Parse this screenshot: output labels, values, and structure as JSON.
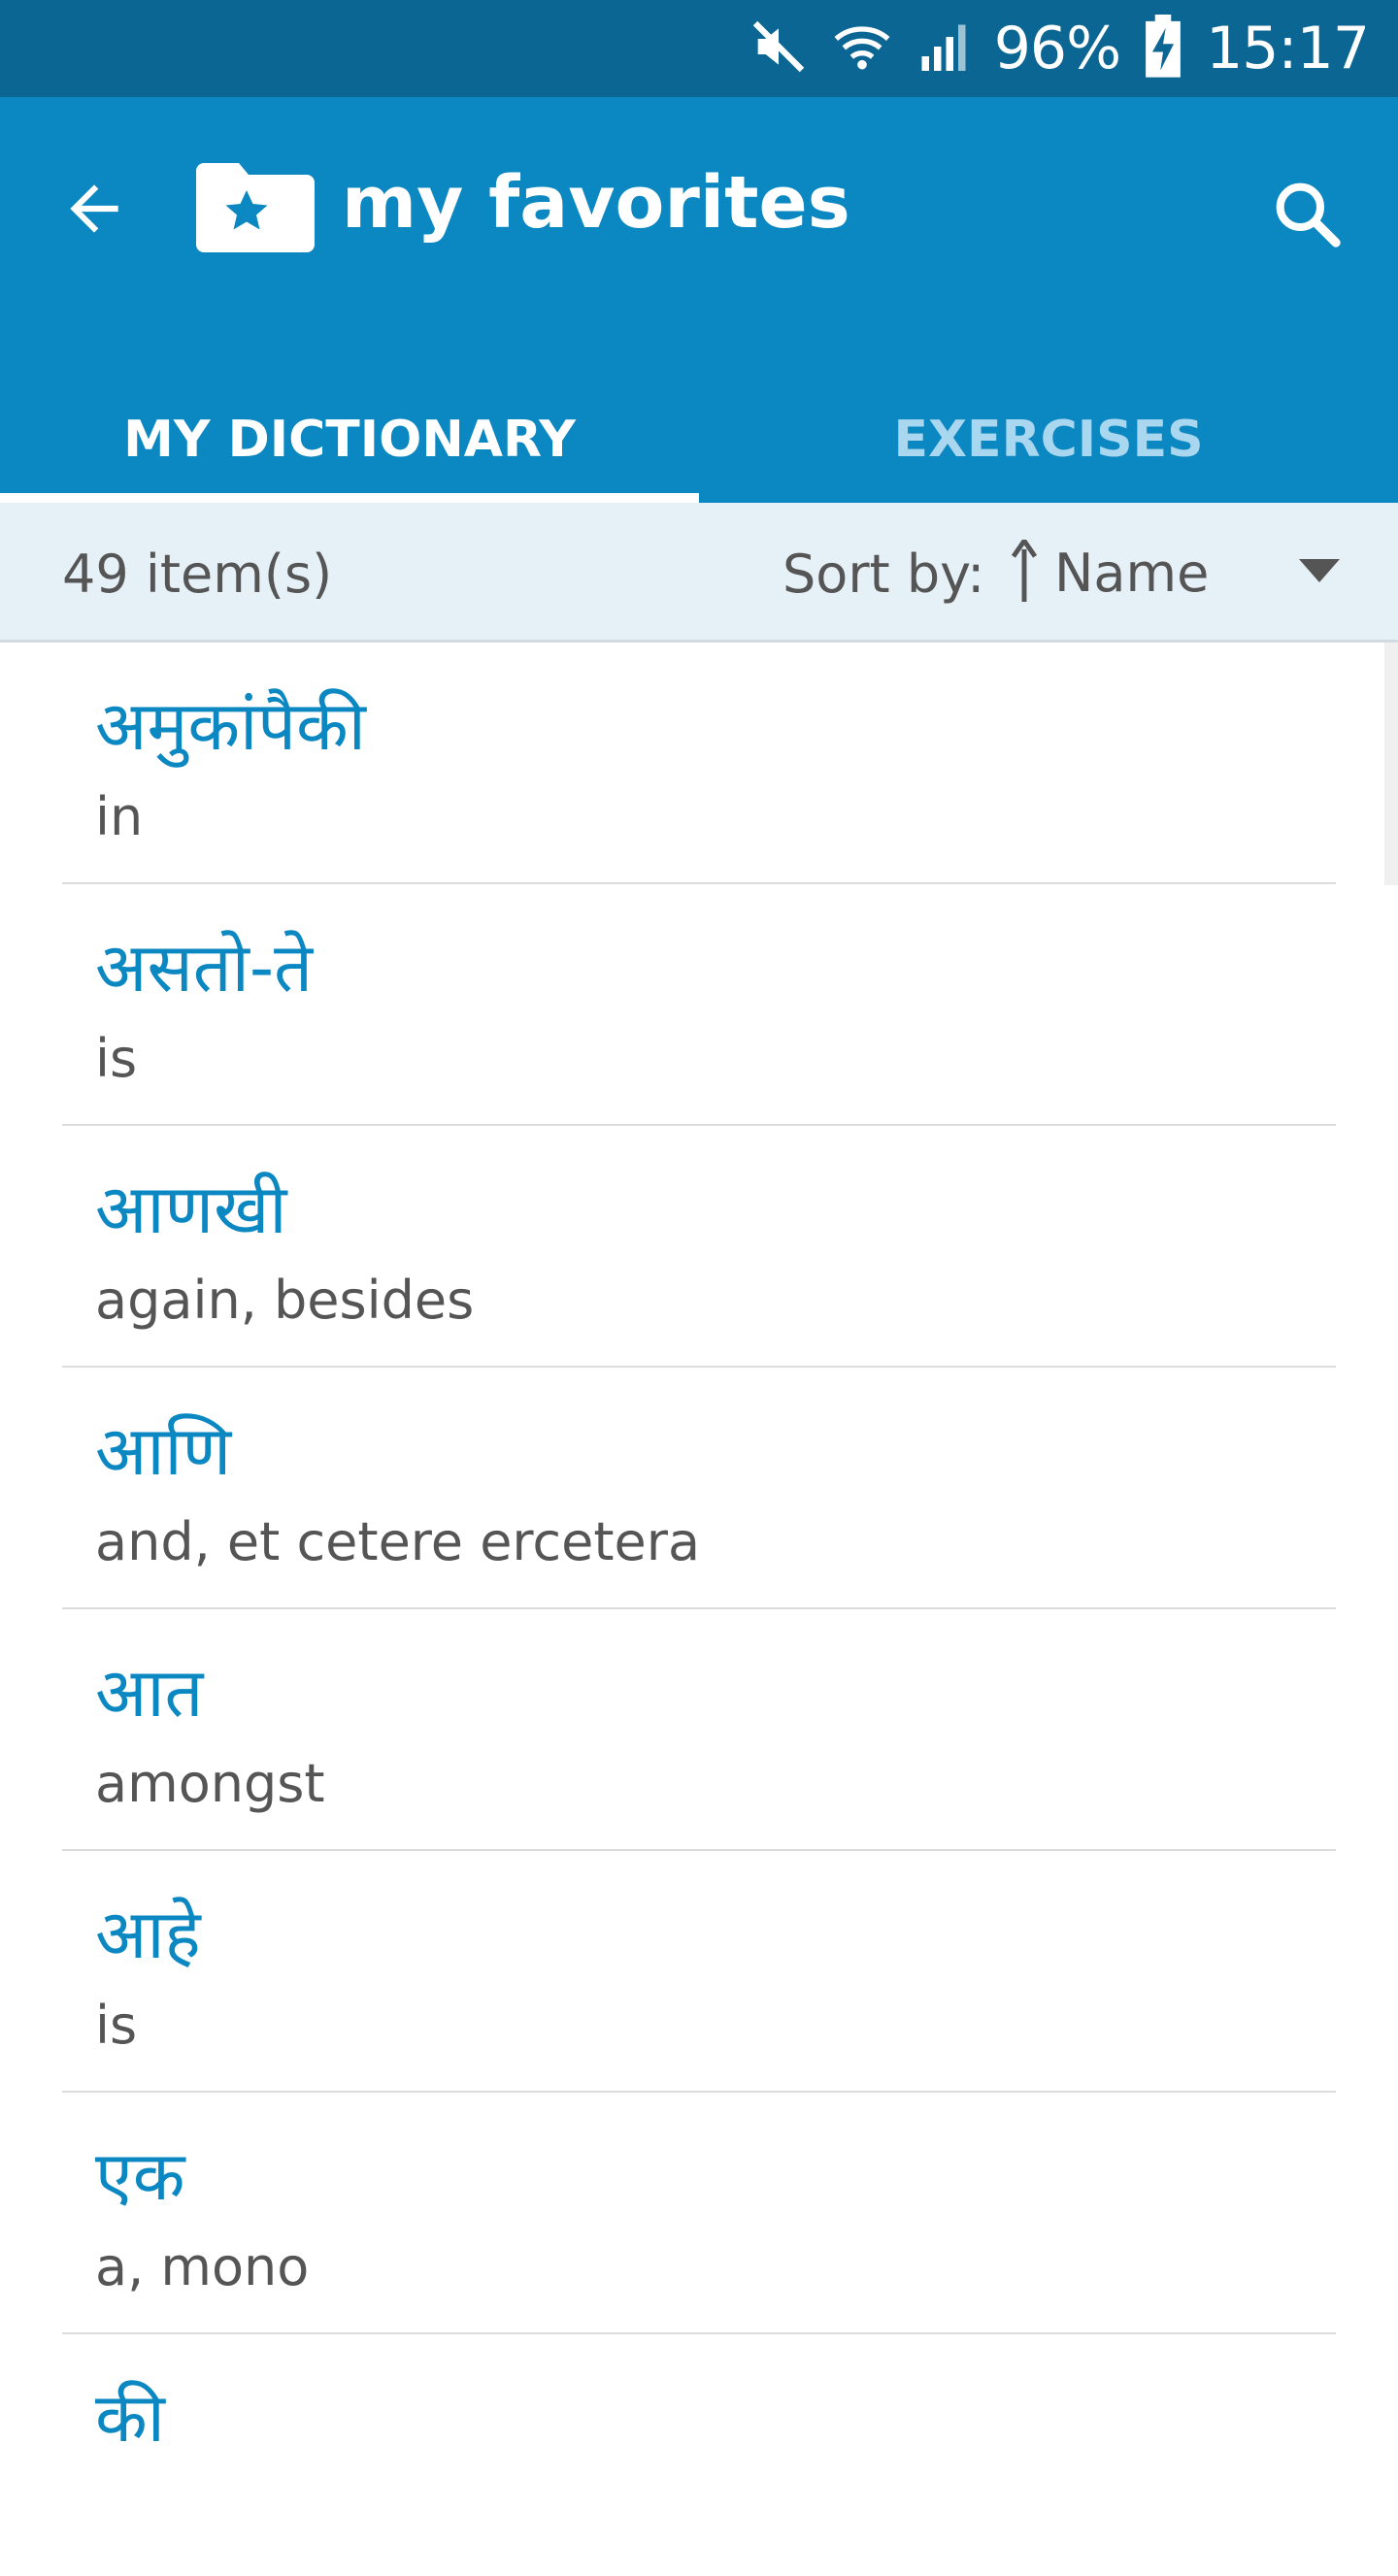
{
  "status_bar": {
    "battery": "96%",
    "time": "15:17",
    "icons": [
      "mute-icon",
      "wifi-icon",
      "signal-icon",
      "battery-charging-icon"
    ]
  },
  "app_bar": {
    "title": "my favorites",
    "back_icon": "arrow-left-icon",
    "folder_icon": "folder-star-icon",
    "search_icon": "search-icon"
  },
  "tabs": [
    {
      "label": "MY DICTIONARY",
      "active": true
    },
    {
      "label": "EXERCISES",
      "active": false
    }
  ],
  "sort_bar": {
    "count": "49 item(s)",
    "sort_label": "Sort by:",
    "sort_value": "Name",
    "sort_direction_icon": "arrow-up-icon",
    "dropdown_icon": "caret-down-icon"
  },
  "items": [
    {
      "term": "अमुकांपैकी",
      "meaning": "in"
    },
    {
      "term": "असतो-ते",
      "meaning": "is"
    },
    {
      "term": "आणखी",
      "meaning": "again, besides"
    },
    {
      "term": "आणि",
      "meaning": "and, et cetere ercetera"
    },
    {
      "term": "आत",
      "meaning": "amongst"
    },
    {
      "term": "आहे",
      "meaning": "is"
    },
    {
      "term": "एक",
      "meaning": "a, mono"
    },
    {
      "term": "की",
      "meaning": ""
    }
  ],
  "colors": {
    "status_bar": "#0b6693",
    "app_bar": "#0b87c1",
    "accent_text": "#0b87c1",
    "sort_bar_bg": "#e5f1f7"
  }
}
